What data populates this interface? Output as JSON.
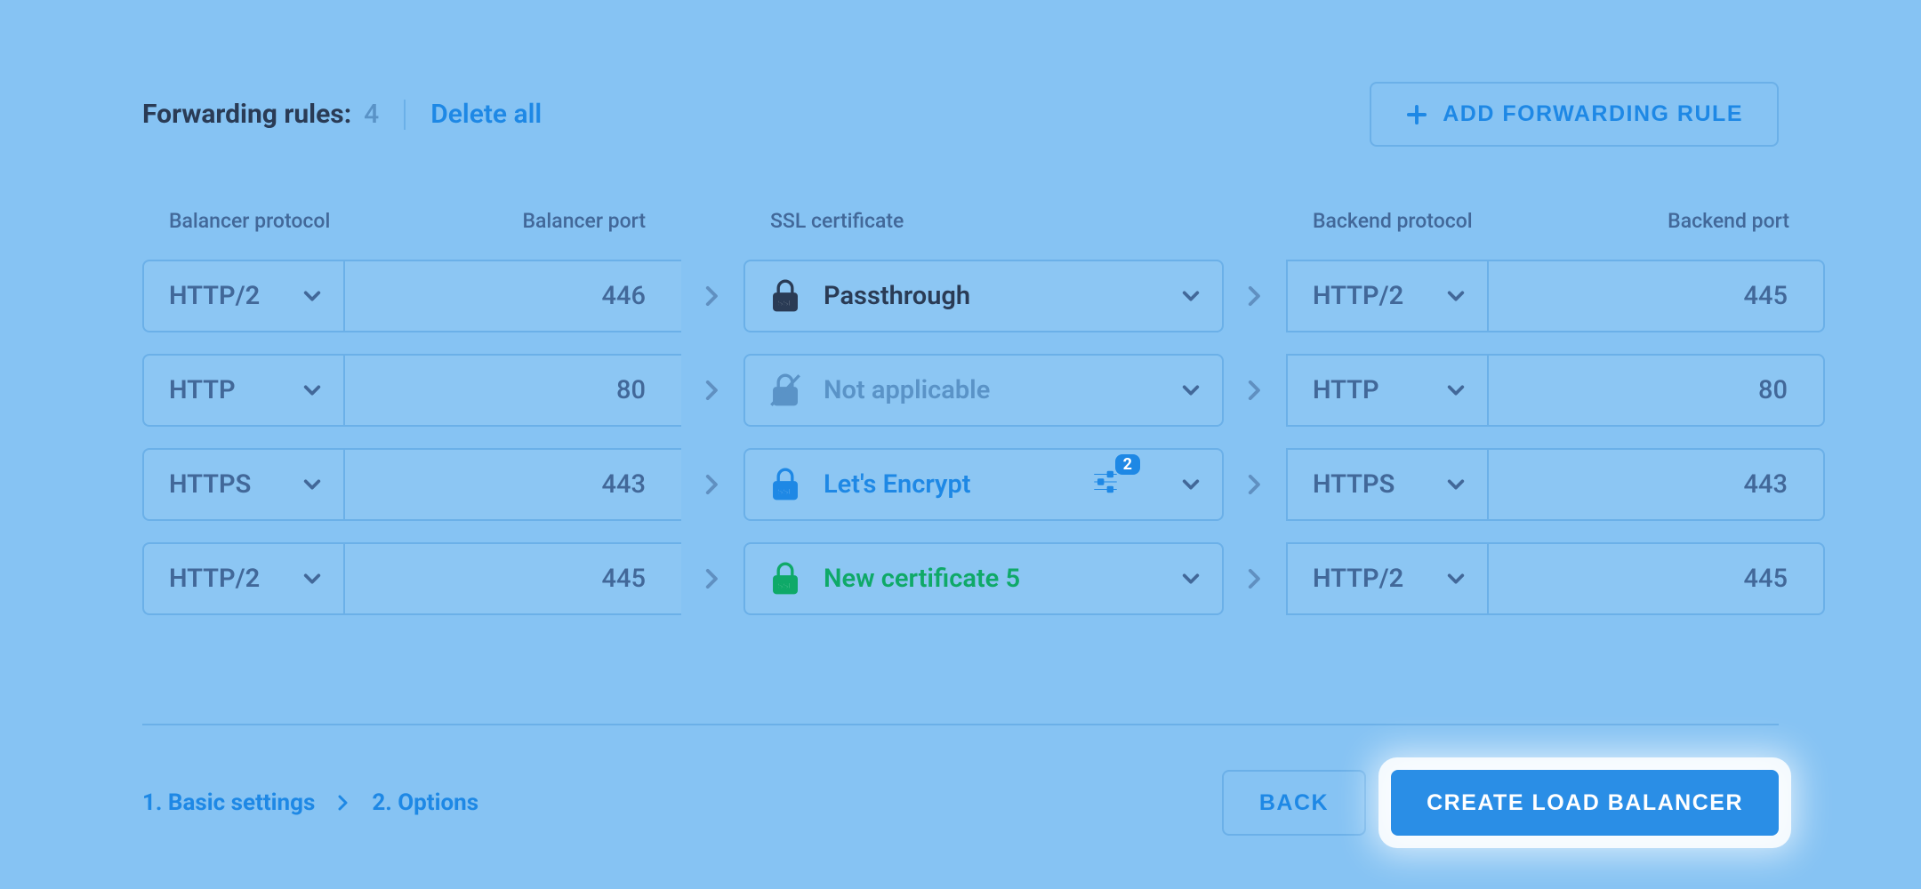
{
  "header": {
    "title": "Forwarding rules:",
    "count": "4",
    "delete_all": "Delete all",
    "add_rule": "ADD FORWARDING RULE"
  },
  "columns": {
    "balancer_protocol": "Balancer protocol",
    "balancer_port": "Balancer port",
    "ssl_cert": "SSL certificate",
    "backend_protocol": "Backend protocol",
    "backend_port": "Backend port"
  },
  "rules": [
    {
      "balancer_protocol": "HTTP/2",
      "balancer_port": "446",
      "ssl": {
        "label": "Passthrough",
        "icon": "lock-dark",
        "style": "dark",
        "tune": false,
        "badge": null
      },
      "backend_protocol": "HTTP/2",
      "backend_port": "445"
    },
    {
      "balancer_protocol": "HTTP",
      "balancer_port": "80",
      "ssl": {
        "label": "Not applicable",
        "icon": "lock-off",
        "style": "muted",
        "tune": false,
        "badge": null
      },
      "backend_protocol": "HTTP",
      "backend_port": "80"
    },
    {
      "balancer_protocol": "HTTPS",
      "balancer_port": "443",
      "ssl": {
        "label": "Let's Encrypt",
        "icon": "lock-blue",
        "style": "blue",
        "tune": true,
        "badge": "2"
      },
      "backend_protocol": "HTTPS",
      "backend_port": "443"
    },
    {
      "balancer_protocol": "HTTP/2",
      "balancer_port": "445",
      "ssl": {
        "label": "New certificate 5",
        "icon": "lock-green",
        "style": "green",
        "tune": false,
        "badge": null
      },
      "backend_protocol": "HTTP/2",
      "backend_port": "445"
    }
  ],
  "footer": {
    "step1": "1. Basic settings",
    "step2": "2. Options",
    "back": "BACK",
    "create": "CREATE LOAD BALANCER"
  }
}
